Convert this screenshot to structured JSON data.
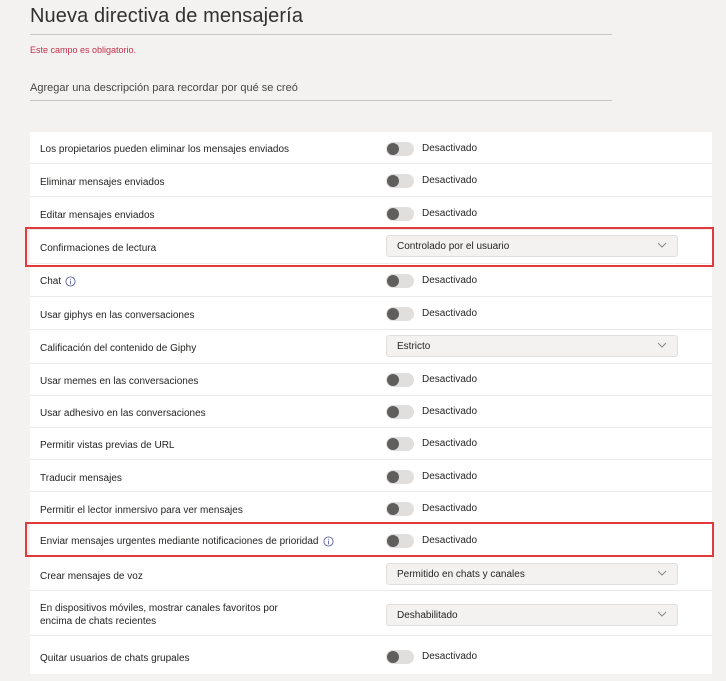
{
  "header": {
    "title": "Nueva directiva de mensajería",
    "error": "Este campo es obligatorio.",
    "description_placeholder": "Agregar una descripción para recordar por qué se creó"
  },
  "settings": [
    {
      "label": "Los propietarios pueden eliminar los mensajes enviados",
      "type": "toggle",
      "value": "Desactivado"
    },
    {
      "label": "Eliminar mensajes enviados",
      "type": "toggle",
      "value": "Desactivado"
    },
    {
      "label": "Editar mensajes enviados",
      "type": "toggle",
      "value": "Desactivado"
    },
    {
      "label": "Confirmaciones de lectura",
      "type": "dropdown",
      "value": "Controlado por el usuario",
      "highlighted": true
    },
    {
      "label": "Chat",
      "type": "toggle",
      "value": "Desactivado",
      "info": "info-icon"
    },
    {
      "label": "Usar giphys en las conversaciones",
      "type": "toggle",
      "value": "Desactivado"
    },
    {
      "label": "Calificación del contenido de Giphy",
      "type": "dropdown",
      "value": "Estricto"
    },
    {
      "label": "Usar memes en las conversaciones",
      "type": "toggle",
      "value": "Desactivado"
    },
    {
      "label": "Usar adhesivo en las conversaciones",
      "type": "toggle",
      "value": "Desactivado"
    },
    {
      "label": "Permitir vistas previas de URL",
      "type": "toggle",
      "value": "Desactivado"
    },
    {
      "label": "Traducir mensajes",
      "type": "toggle",
      "value": "Desactivado"
    },
    {
      "label": "Permitir el lector inmersivo para ver mensajes",
      "type": "toggle",
      "value": "Desactivado"
    },
    {
      "label": "Enviar mensajes urgentes mediante notificaciones de prioridad",
      "type": "toggle",
      "value": "Desactivado",
      "info": "info-icon",
      "highlighted": true
    },
    {
      "label": "Crear mensajes de voz",
      "type": "dropdown",
      "value": "Permitido en chats y canales"
    },
    {
      "label_line1": "En dispositivos móviles, mostrar canales favoritos por",
      "label_line2": "encima de chats recientes",
      "type": "dropdown",
      "value": "Deshabilitado"
    },
    {
      "label": "Quitar usuarios de chats grupales",
      "type": "toggle",
      "value": "Desactivado"
    }
  ],
  "colors": {
    "highlight": "#e0393e",
    "error": "#c4314b",
    "toggle_off_track": "#e1dfdd",
    "toggle_off_knob": "#605e5c"
  }
}
